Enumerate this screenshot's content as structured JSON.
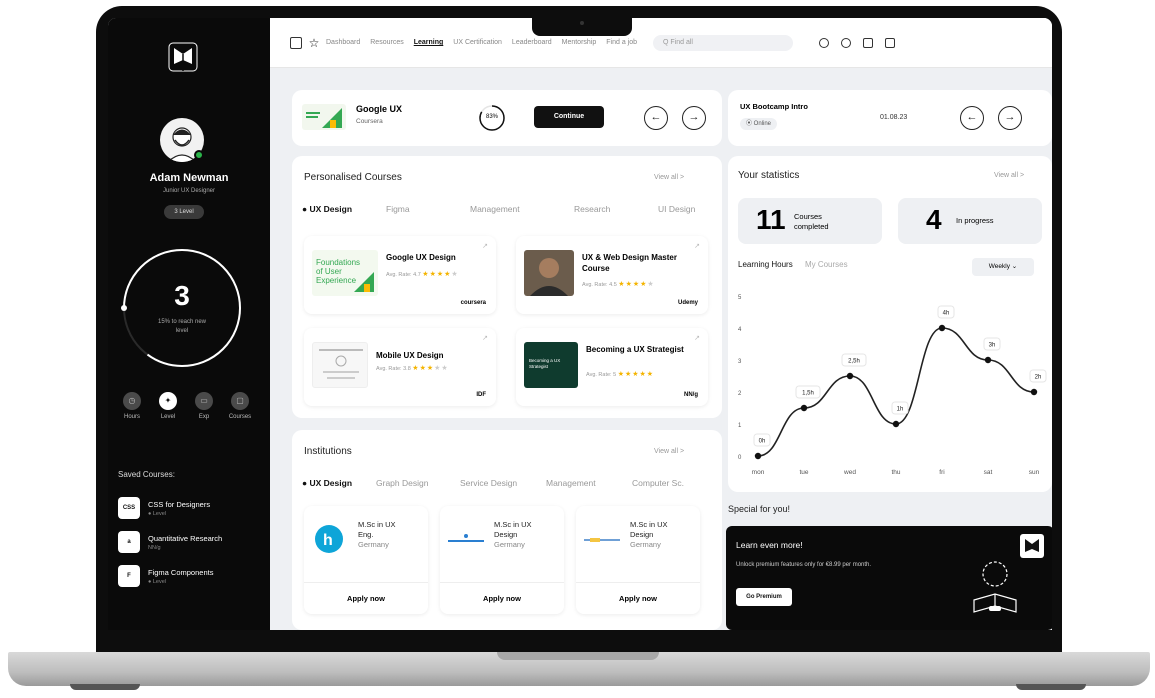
{
  "sidebar": {
    "user_name": "Adam Newman",
    "user_role": "Junior UX Designer",
    "level_badge": "3 Level",
    "level_number": "3",
    "level_text": "15% to reach new level",
    "stats": [
      {
        "label": "Hours",
        "icon": "clock-icon"
      },
      {
        "label": "Level",
        "icon": "compass-icon"
      },
      {
        "label": "Exp",
        "icon": "briefcase-icon"
      },
      {
        "label": "Courses",
        "icon": "book-icon"
      }
    ],
    "saved_title": "Saved Courses:",
    "saved": [
      {
        "name": "CSS for Designers",
        "sub": "● Level",
        "thumb": "CSS"
      },
      {
        "name": "Quantitative Research",
        "sub": "NN/g",
        "thumb": "a"
      },
      {
        "name": "Figma Components",
        "sub": "● Level",
        "thumb": "F"
      }
    ]
  },
  "nav": {
    "links": [
      "Dashboard",
      "Resources",
      "Learning",
      "UX Certification",
      "Leaderboard",
      "Mentorship",
      "Find a job"
    ],
    "active": "Learning",
    "search_placeholder": "Q Find all"
  },
  "course_strip": {
    "title": "Google UX",
    "subtitle": "Coursera",
    "progress": "83%",
    "progress_fraction": 0.83,
    "continue_label": "Continue"
  },
  "bootcamp": {
    "title": "UX Bootcamp Intro",
    "badge": "Online",
    "date": "01.08.23"
  },
  "personalised": {
    "title": "Personalised Courses",
    "view_all": "View all >",
    "tabs": [
      "UX Design",
      "Figma",
      "Management",
      "Research",
      "UI Design"
    ],
    "courses": [
      {
        "name": "Google UX Design",
        "rate": "Avg. Rate: 4.7",
        "stars": 4,
        "provider": "coursera",
        "thumb_text": "Foundations of User Experience"
      },
      {
        "name": "UX & Web Design Master Course",
        "rate": "Avg. Rate: 4.5",
        "stars": 4,
        "provider": "Udemy"
      },
      {
        "name": "Mobile UX Design",
        "rate": "Avg. Rate: 3.8",
        "stars": 3,
        "provider": "IDF"
      },
      {
        "name": "Becoming a UX Strategist",
        "rate": "Avg. Rate: 5",
        "stars": 5,
        "provider": "NN/g",
        "thumb_text": "Becoming a UX Strategist"
      }
    ]
  },
  "institutions": {
    "title": "Institutions",
    "view_all": "View all >",
    "tabs": [
      "UX Design",
      "Graph Design",
      "Service Design",
      "Management",
      "Computer Sc."
    ],
    "items": [
      {
        "line1": "M.Sc in UX",
        "line2": "Eng.",
        "country": "Germany",
        "apply": "Apply now"
      },
      {
        "line1": "M.Sc in UX",
        "line2": "Design",
        "country": "Germany",
        "apply": "Apply now"
      },
      {
        "line1": "M.Sc in UX",
        "line2": "Design",
        "country": "Germany",
        "apply": "Apply now"
      }
    ]
  },
  "statistics": {
    "title": "Your statistics",
    "view_all": "View all >",
    "completed_num": "11",
    "completed_label": "Courses completed",
    "progress_num": "4",
    "progress_label": "In progress",
    "tab_active": "Learning Hours",
    "tab_other": "My Courses",
    "period": "Weekly ⌄"
  },
  "chart_data": {
    "type": "line",
    "categories": [
      "mon",
      "tue",
      "wed",
      "thu",
      "fri",
      "sat",
      "sun"
    ],
    "values": [
      0,
      1.5,
      2.5,
      1,
      4,
      3,
      2
    ],
    "data_labels": [
      "0h",
      "1,5h",
      "2,5h",
      "1h",
      "4h",
      "3h",
      "2h"
    ],
    "yticks": [
      "0",
      "1",
      "2",
      "3",
      "4",
      "5"
    ],
    "ylim": [
      0,
      5
    ]
  },
  "special": {
    "title": "Special for you!",
    "card_title": "Learn even more!",
    "card_text": "Unlock premium features only for €8.99 per month.",
    "button": "Go Premium"
  },
  "colors": {
    "accent_dark": "#0a0a0a",
    "star": "#f4b400",
    "online": "#2bb44a",
    "google_green": "#34a853"
  }
}
